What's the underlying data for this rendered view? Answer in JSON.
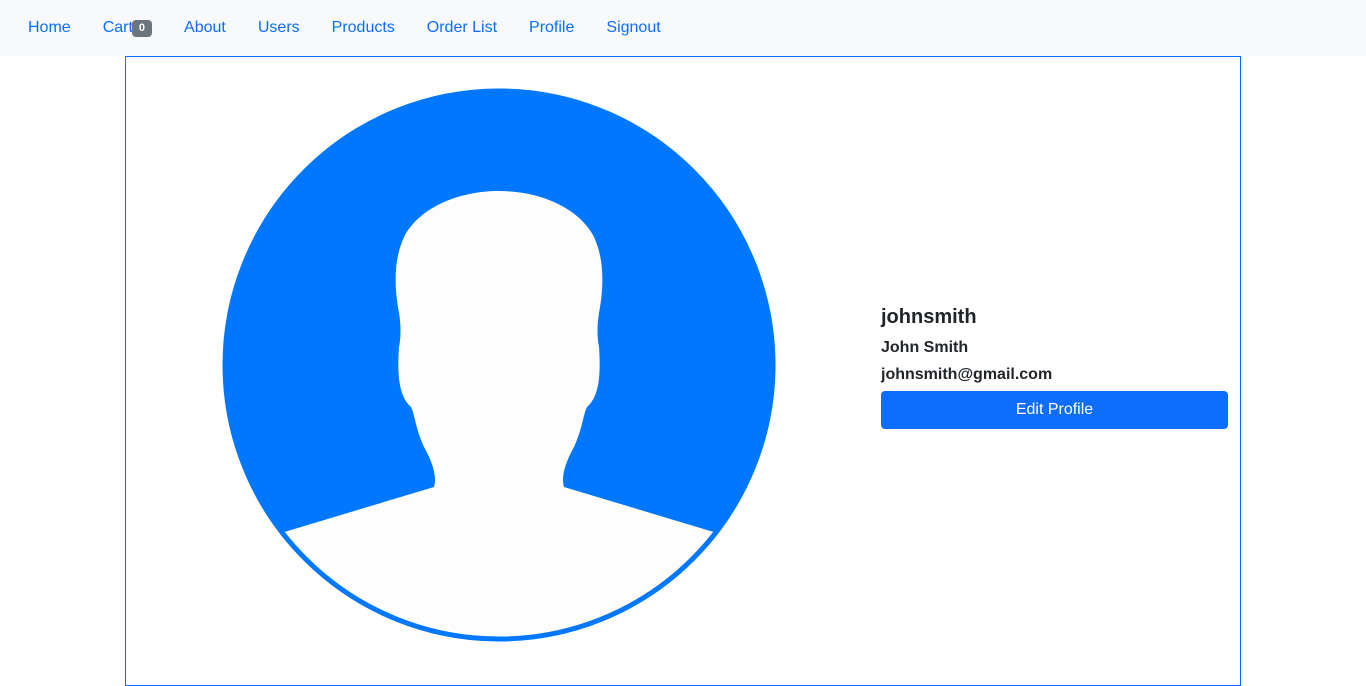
{
  "nav": {
    "items": [
      {
        "label": "Home"
      },
      {
        "label": "Cart"
      },
      {
        "label": "About"
      },
      {
        "label": "Users"
      },
      {
        "label": "Products"
      },
      {
        "label": "Order List"
      },
      {
        "label": "Profile"
      },
      {
        "label": "Signout"
      }
    ],
    "cart_count": "0"
  },
  "profile": {
    "username": "johnsmith",
    "full_name": "John Smith",
    "email": "johnsmith@gmail.com",
    "edit_button_label": "Edit Profile",
    "avatar_icon": "user-silhouette-icon"
  },
  "colors": {
    "accent": "#0d6efd",
    "avatar_blue": "#0077ff",
    "navbar_bg": "#f8f9fa",
    "badge_bg": "#6c757d"
  }
}
